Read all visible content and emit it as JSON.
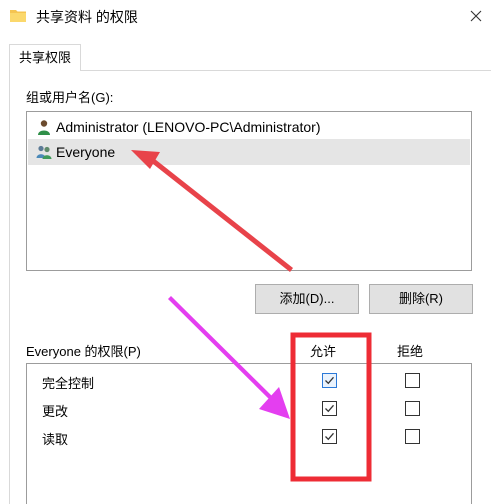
{
  "window": {
    "title": "共享资料 的权限",
    "folder_icon": "folder-icon",
    "close_icon": "close-icon"
  },
  "tabs": [
    {
      "label": "共享权限",
      "selected": true
    }
  ],
  "users_section": {
    "label": "组或用户名(G):",
    "users": [
      {
        "name": "Administrator (LENOVO-PC\\Administrator)",
        "icon": "single-user-icon",
        "selected": false
      },
      {
        "name": "Everyone",
        "icon": "user-group-icon",
        "selected": true
      }
    ]
  },
  "buttons": {
    "add": "添加(D)...",
    "remove": "删除(R)"
  },
  "permissions": {
    "label": "Everyone 的权限(P)",
    "col_allow": "允许",
    "col_deny": "拒绝",
    "rows": [
      {
        "name": "完全控制",
        "allow": true,
        "deny": false
      },
      {
        "name": "更改",
        "allow": true,
        "deny": false
      },
      {
        "name": "读取",
        "allow": true,
        "deny": false
      }
    ]
  },
  "annotation_colors": {
    "arrow_red": "#e8434a",
    "arrow_magenta": "#e43ef0",
    "highlight_box": "#ee2c35"
  }
}
